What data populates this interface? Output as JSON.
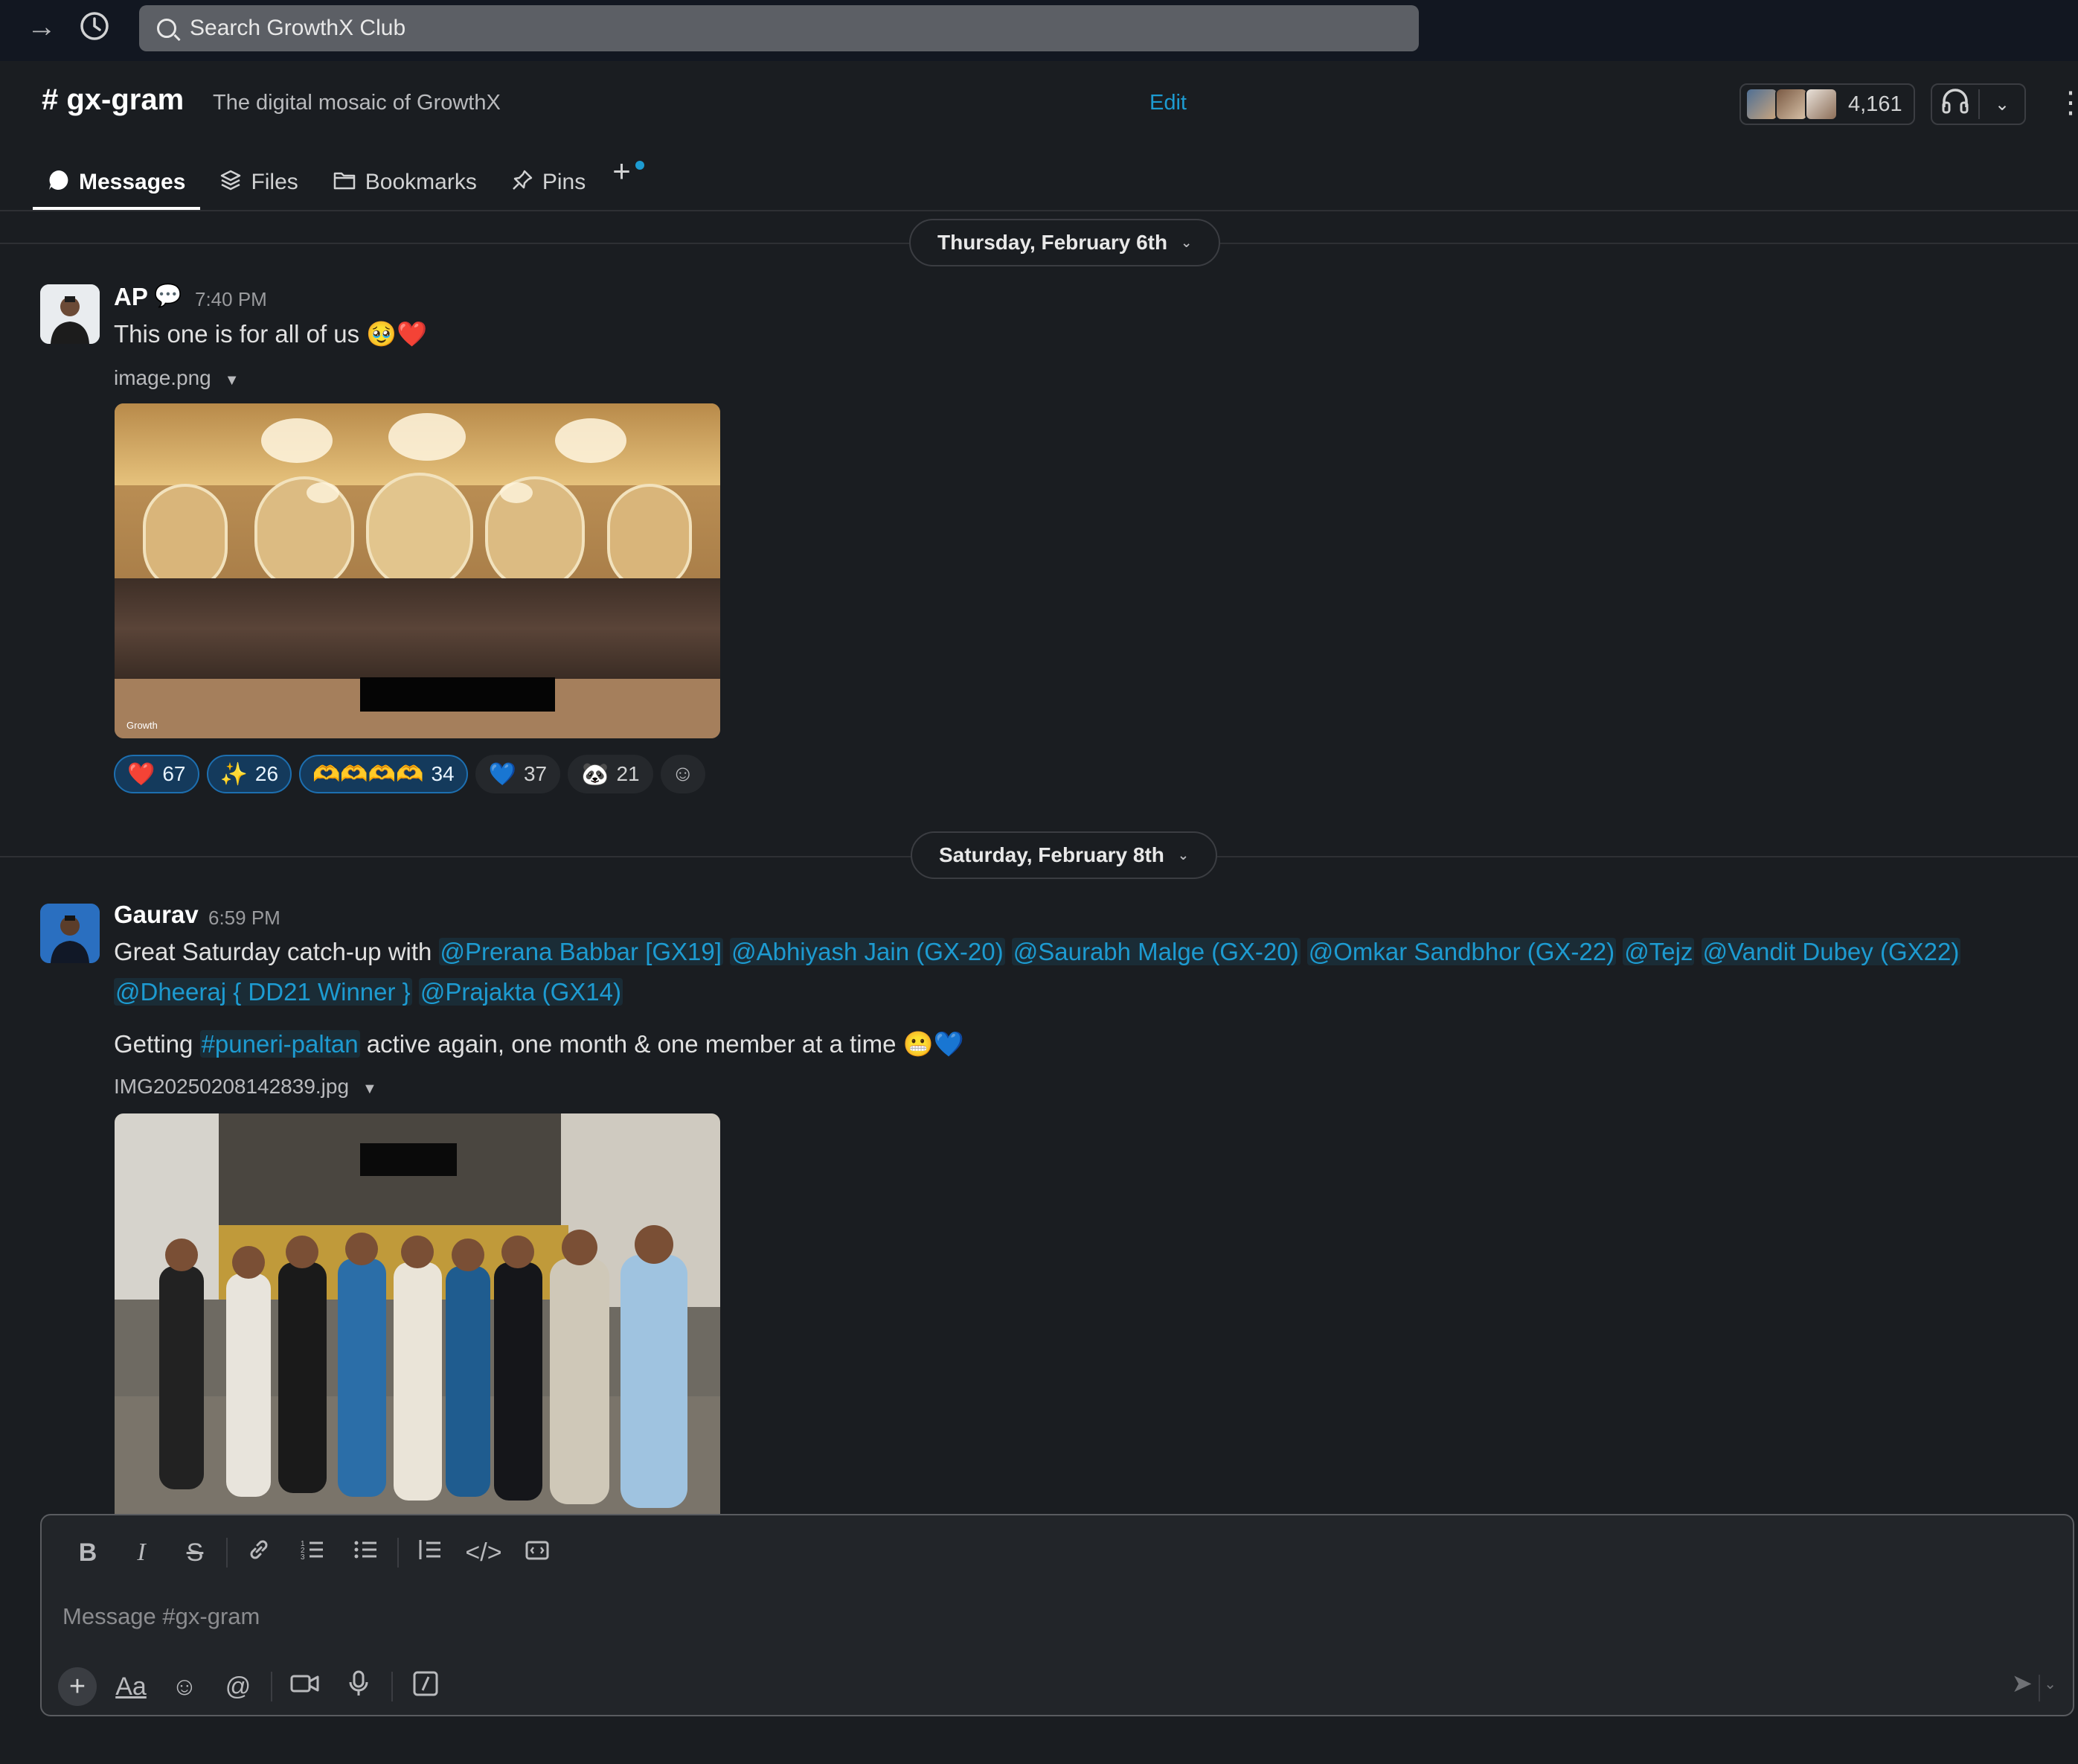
{
  "topbar": {
    "forward_icon": "arrow-right-icon",
    "history_icon": "clock-icon",
    "search_placeholder": "Search GrowthX Club"
  },
  "channel": {
    "name": "# gx-gram",
    "description": "The digital mosaic of GrowthX",
    "edit_label": "Edit",
    "member_count": "4,161"
  },
  "tabs": [
    {
      "label": "Messages",
      "icon": "message-bubble-icon",
      "active": true
    },
    {
      "label": "Files",
      "icon": "layers-icon",
      "active": false
    },
    {
      "label": "Bookmarks",
      "icon": "folder-icon",
      "active": false
    },
    {
      "label": "Pins",
      "icon": "pin-icon",
      "active": false
    }
  ],
  "days": [
    {
      "label": "Thursday, February 6th"
    },
    {
      "label": "Saturday, February 8th"
    }
  ],
  "messages": [
    {
      "author": "AP",
      "time": "7:40 PM",
      "text": "This one is for all of us",
      "emojis": "🥹❤️",
      "file": "image.png",
      "reactions": [
        {
          "emoji": "❤️",
          "count": "67",
          "mine": true
        },
        {
          "emoji": "✨",
          "count": "26",
          "mine": true
        },
        {
          "emoji": "🫶🫶🫶🫶",
          "count": "34",
          "mine": true
        },
        {
          "emoji": "💙",
          "count": "37",
          "mine": false
        },
        {
          "emoji": "🐼",
          "count": "21",
          "mine": false
        }
      ]
    },
    {
      "author": "Gaurav",
      "time": "6:59 PM",
      "text_start": "Great Saturday catch-up with",
      "mentions": [
        "@Prerana Babbar [GX19]",
        "@Abhiyash Jain (GX-20)",
        "@Saurabh Malge (GX-20)",
        "@Omkar Sandbhor (GX-22)",
        "@Tejz",
        "@Vandit Dubey (GX22)",
        "@Dheeraj { DD21 Winner }",
        "@Prajakta (GX14)"
      ],
      "line2_start": "Getting",
      "channel_link": "#puneri-paltan",
      "line2_end": "active again, one month & one member at a time",
      "line2_emojis": "😬💙",
      "file": "IMG20250208142839.jpg"
    }
  ],
  "composer": {
    "placeholder": "Message #gx-gram"
  },
  "colors": {
    "background": "#1a1d21",
    "topbar": "#121721",
    "link": "#1d9bd1",
    "reaction_mine_bg": "#143a5c"
  }
}
